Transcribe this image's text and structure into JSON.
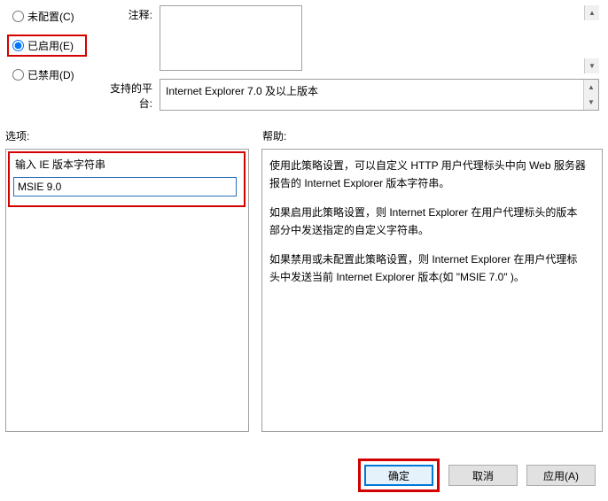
{
  "radios": {
    "not_configured": "未配置(C)",
    "enabled": "已启用(E)",
    "disabled": "已禁用(D)",
    "selected": "enabled"
  },
  "comment": {
    "label": "注释:",
    "value": ""
  },
  "platform": {
    "label": "支持的平台:",
    "value": "Internet Explorer 7.0 及以上版本"
  },
  "sections": {
    "options": "选项:",
    "help": "帮助:"
  },
  "options": {
    "input_label": "输入 IE 版本字符串",
    "input_value": "MSIE 9.0"
  },
  "help": {
    "p1": "使用此策略设置，可以自定义 HTTP 用户代理标头中向 Web 服务器报告的 Internet Explorer 版本字符串。",
    "p2": "如果启用此策略设置，则 Internet Explorer 在用户代理标头的版本部分中发送指定的自定义字符串。",
    "p3": "如果禁用或未配置此策略设置，则 Internet Explorer 在用户代理标头中发送当前 Internet Explorer 版本(如 \"MSIE 7.0\" )。"
  },
  "buttons": {
    "ok": "确定",
    "cancel": "取消",
    "apply": "应用(A)"
  }
}
